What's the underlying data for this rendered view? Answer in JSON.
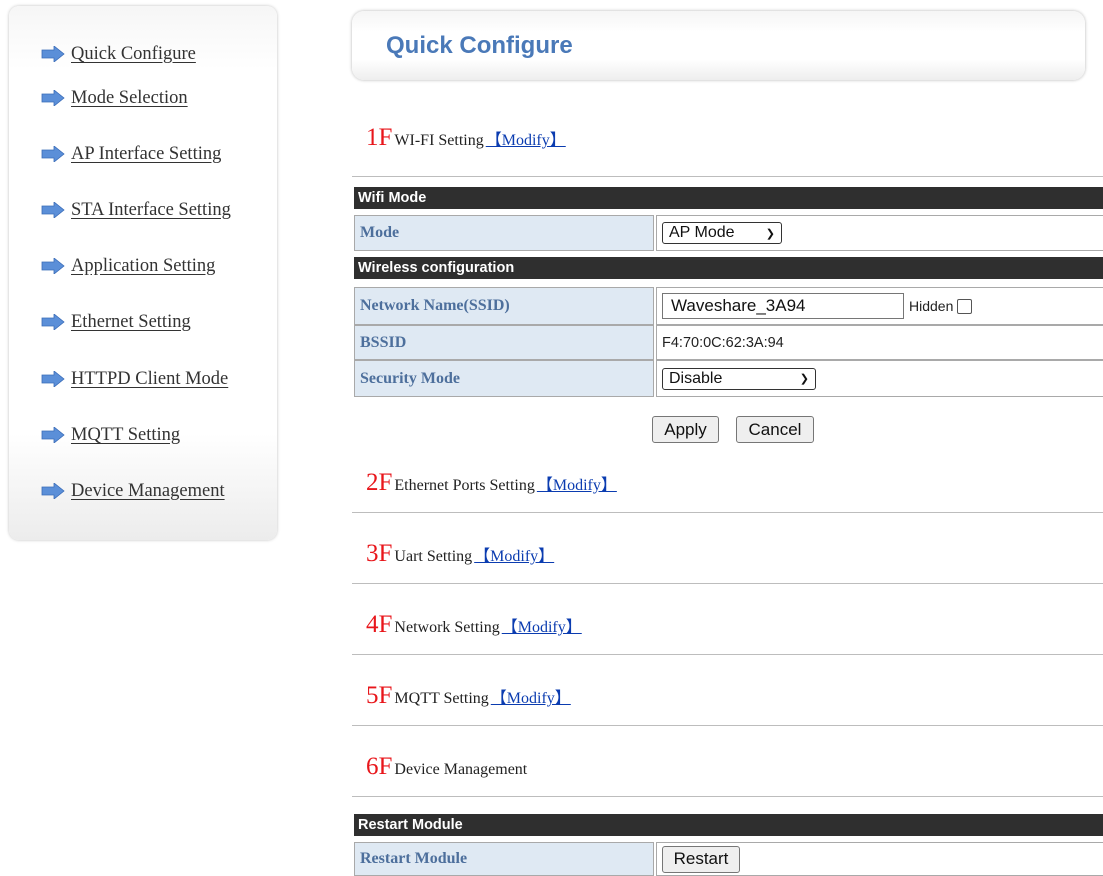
{
  "sidebar": {
    "items": [
      {
        "label": "Quick Configure"
      },
      {
        "label": "Mode Selection"
      },
      {
        "label": "AP Interface Setting"
      },
      {
        "label": "STA Interface Setting"
      },
      {
        "label": "Application Setting"
      },
      {
        "label": "Ethernet Setting"
      },
      {
        "label": "HTTPD Client Mode"
      },
      {
        "label": "MQTT Setting"
      },
      {
        "label": "Device Management"
      }
    ],
    "arrow_color": "#5b8fd8"
  },
  "header": {
    "title": "Quick Configure"
  },
  "floors": [
    {
      "num": "1F",
      "name": "WI-FI Setting",
      "modify": "【Modify】"
    },
    {
      "num": "2F",
      "name": "Ethernet Ports Setting",
      "modify": "【Modify】"
    },
    {
      "num": "3F",
      "name": "Uart Setting",
      "modify": "【Modify】"
    },
    {
      "num": "4F",
      "name": "Network Setting",
      "modify": "【Modify】"
    },
    {
      "num": "5F",
      "name": "MQTT Setting",
      "modify": "【Modify】"
    },
    {
      "num": "6F",
      "name": "Device Management"
    }
  ],
  "wifi": {
    "section_mode": "Wifi Mode",
    "mode_label": "Mode",
    "mode_value": "AP Mode",
    "section_wireless": "Wireless configuration",
    "ssid_label": "Network Name(SSID)",
    "ssid_value": "Waveshare_3A94",
    "hidden_label": "Hidden",
    "hidden_checked": false,
    "bssid_label": "BSSID",
    "bssid_value": "F4:70:0C:62:3A:94",
    "security_label": "Security Mode",
    "security_value": "Disable",
    "apply_label": "Apply",
    "cancel_label": "Cancel"
  },
  "device": {
    "section_restart": "Restart Module",
    "restart_label": "Restart Module",
    "restart_button": "Restart"
  },
  "colors": {
    "floor_number": "#e8161b",
    "modify_link": "#0b3cb0",
    "title": "#4a79b8",
    "section_bar": "#2f2f2f",
    "label_cell_bg": "#dfe9f3",
    "label_cell_text": "#4d6f9c"
  }
}
